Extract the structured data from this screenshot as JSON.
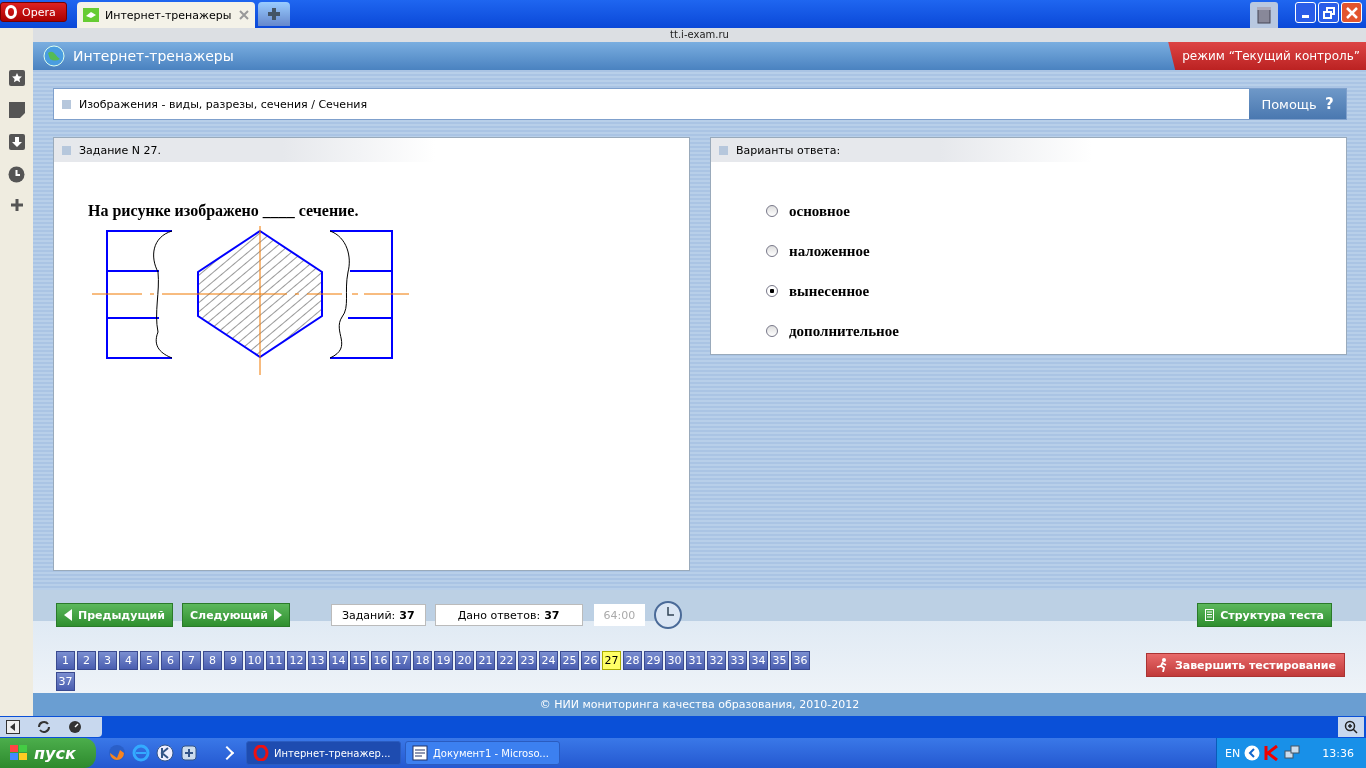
{
  "browser": {
    "opera_button": "Opera",
    "tabs": [
      {
        "label": "Интернет-тренажеры",
        "selected": true
      }
    ],
    "address": "tt.i-exam.ru"
  },
  "page": {
    "site_title": "Интернет-тренажеры",
    "mode_badge": "режим “Текущий контроль”",
    "breadcrumb": "Изображения - виды, разрезы, сечения / Сечения",
    "help_button": "Помощь",
    "help_icon": "?"
  },
  "task": {
    "title": "Задание N 27.",
    "question": "На рисунке изображено ____ сечение."
  },
  "answers": {
    "title": "Варианты ответа:",
    "options": [
      {
        "label": "основное",
        "selected": false
      },
      {
        "label": "наложенное",
        "selected": false
      },
      {
        "label": "вынесенное",
        "selected": true
      },
      {
        "label": "дополнительное",
        "selected": false
      }
    ]
  },
  "nav": {
    "prev": "Предыдущий",
    "next": "Следующий",
    "tasks_label": "Заданий:",
    "tasks_count": "37",
    "answered_label": "Дано ответов:",
    "answered_count": "37",
    "timer": "64:00",
    "structure_button": "Структура теста",
    "finish_button": "Завершить тестирование"
  },
  "task_numbers": [
    {
      "label": "1",
      "selected": false
    },
    {
      "label": "2",
      "selected": false
    },
    {
      "label": "3",
      "selected": false
    },
    {
      "label": "4",
      "selected": false
    },
    {
      "label": "5",
      "selected": false
    },
    {
      "label": "6",
      "selected": false
    },
    {
      "label": "7",
      "selected": false
    },
    {
      "label": "8",
      "selected": false
    },
    {
      "label": "9",
      "selected": false
    },
    {
      "label": "10",
      "selected": false
    },
    {
      "label": "11",
      "selected": false
    },
    {
      "label": "12",
      "selected": false
    },
    {
      "label": "13",
      "selected": false
    },
    {
      "label": "14",
      "selected": false
    },
    {
      "label": "15",
      "selected": false
    },
    {
      "label": "16",
      "selected": false
    },
    {
      "label": "17",
      "selected": false
    },
    {
      "label": "18",
      "selected": false
    },
    {
      "label": "19",
      "selected": false
    },
    {
      "label": "20",
      "selected": false
    },
    {
      "label": "21",
      "selected": false
    },
    {
      "label": "22",
      "selected": false
    },
    {
      "label": "23",
      "selected": false
    },
    {
      "label": "24",
      "selected": false
    },
    {
      "label": "25",
      "selected": false
    },
    {
      "label": "26",
      "selected": false
    },
    {
      "label": "27",
      "selected": true
    },
    {
      "label": "28",
      "selected": false
    },
    {
      "label": "29",
      "selected": false
    },
    {
      "label": "30",
      "selected": false
    },
    {
      "label": "31",
      "selected": false
    },
    {
      "label": "32",
      "selected": false
    },
    {
      "label": "33",
      "selected": false
    },
    {
      "label": "34",
      "selected": false
    },
    {
      "label": "35",
      "selected": false
    },
    {
      "label": "36",
      "selected": false
    },
    {
      "label": "37",
      "selected": false
    }
  ],
  "footer": "© НИИ мониторинга качества образования, 2010-2012",
  "taskbar": {
    "start": "пуск",
    "windows": [
      {
        "label": "Интернет-тренажер...",
        "selected": true
      },
      {
        "label": "Документ1 - Microso...",
        "selected": false
      }
    ],
    "language": "EN",
    "clock": "13:36"
  }
}
